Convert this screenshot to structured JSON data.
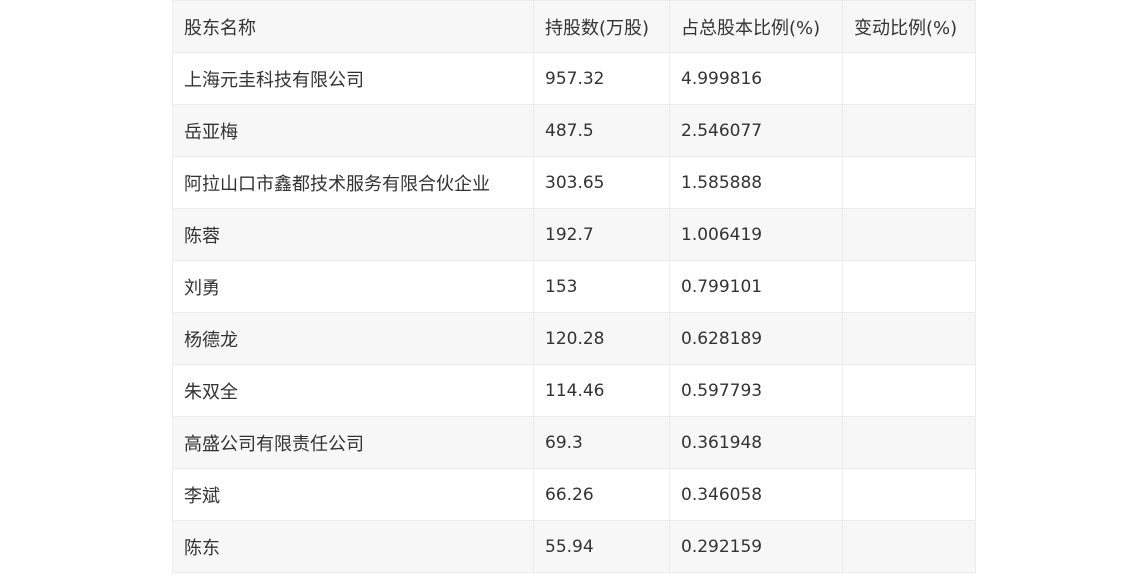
{
  "table": {
    "headers": [
      "股东名称",
      "持股数(万股)",
      "占总股本比例(%)",
      "变动比例(%)"
    ],
    "rows": [
      [
        "上海元圭科技有限公司",
        "957.32",
        "4.999816",
        ""
      ],
      [
        "岳亚梅",
        "487.5",
        "2.546077",
        ""
      ],
      [
        "阿拉山口市鑫都技术服务有限合伙企业",
        "303.65",
        "1.585888",
        ""
      ],
      [
        "陈蓉",
        "192.7",
        "1.006419",
        ""
      ],
      [
        "刘勇",
        "153",
        "0.799101",
        ""
      ],
      [
        "杨德龙",
        "120.28",
        "0.628189",
        ""
      ],
      [
        "朱双全",
        "114.46",
        "0.597793",
        ""
      ],
      [
        "高盛公司有限责任公司",
        "69.3",
        "0.361948",
        ""
      ],
      [
        "李斌",
        "66.26",
        "0.346058",
        ""
      ],
      [
        "陈东",
        "55.94",
        "0.292159",
        ""
      ]
    ]
  }
}
